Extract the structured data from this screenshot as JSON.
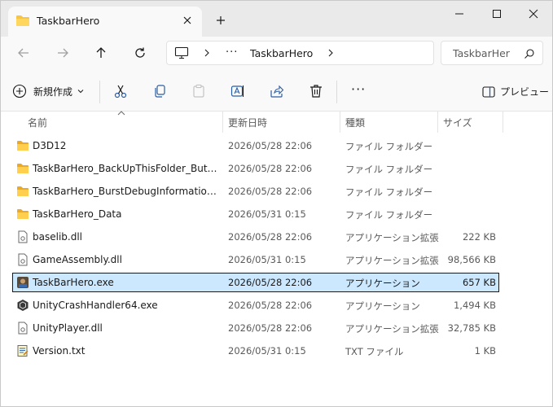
{
  "window": {
    "tab_title": "TaskbarHero"
  },
  "address": {
    "crumbs": [
      "TaskbarHero"
    ],
    "overflow": "···"
  },
  "search": {
    "placeholder": "TaskbarHero"
  },
  "commands": {
    "new_label": "新規作成",
    "preview_label": "プレビュー",
    "more": "···"
  },
  "columns": {
    "name": "名前",
    "date": "更新日時",
    "type": "種類",
    "size": "サイズ"
  },
  "files": [
    {
      "name": "D3D12",
      "date": "2026/05/28 22:06",
      "type": "ファイル フォルダー",
      "size": "",
      "icon": "folder-icon"
    },
    {
      "name": "TaskBarHero_BackUpThisFolder_ButDontShipItWithYourGame",
      "date": "2026/05/28 22:06",
      "type": "ファイル フォルダー",
      "size": "",
      "icon": "folder-icon"
    },
    {
      "name": "TaskBarHero_BurstDebugInformation_DoNotShip",
      "date": "2026/05/28 22:06",
      "type": "ファイル フォルダー",
      "size": "",
      "icon": "folder-icon"
    },
    {
      "name": "TaskBarHero_Data",
      "date": "2026/05/31 0:15",
      "type": "ファイル フォルダー",
      "size": "",
      "icon": "folder-icon"
    },
    {
      "name": "baselib.dll",
      "date": "2026/05/28 22:06",
      "type": "アプリケーション拡張",
      "size": "222 KB",
      "icon": "dll-icon"
    },
    {
      "name": "GameAssembly.dll",
      "date": "2026/05/31 0:15",
      "type": "アプリケーション拡張",
      "size": "98,566 KB",
      "icon": "dll-icon"
    },
    {
      "name": "TaskBarHero.exe",
      "date": "2026/05/28 22:06",
      "type": "アプリケーション",
      "size": "657 KB",
      "icon": "game-exe-icon",
      "selected": true
    },
    {
      "name": "UnityCrashHandler64.exe",
      "date": "2026/05/28 22:06",
      "type": "アプリケーション",
      "size": "1,494 KB",
      "icon": "unity-exe-icon"
    },
    {
      "name": "UnityPlayer.dll",
      "date": "2026/05/28 22:06",
      "type": "アプリケーション拡張",
      "size": "32,785 KB",
      "icon": "dll-icon"
    },
    {
      "name": "Version.txt",
      "date": "2026/05/31 0:15",
      "type": "TXT ファイル",
      "size": "1 KB",
      "icon": "text-file-icon"
    }
  ],
  "colors": {
    "accent": "#0067c0",
    "selection": "#cce8ff",
    "folder": "#f8c444"
  }
}
